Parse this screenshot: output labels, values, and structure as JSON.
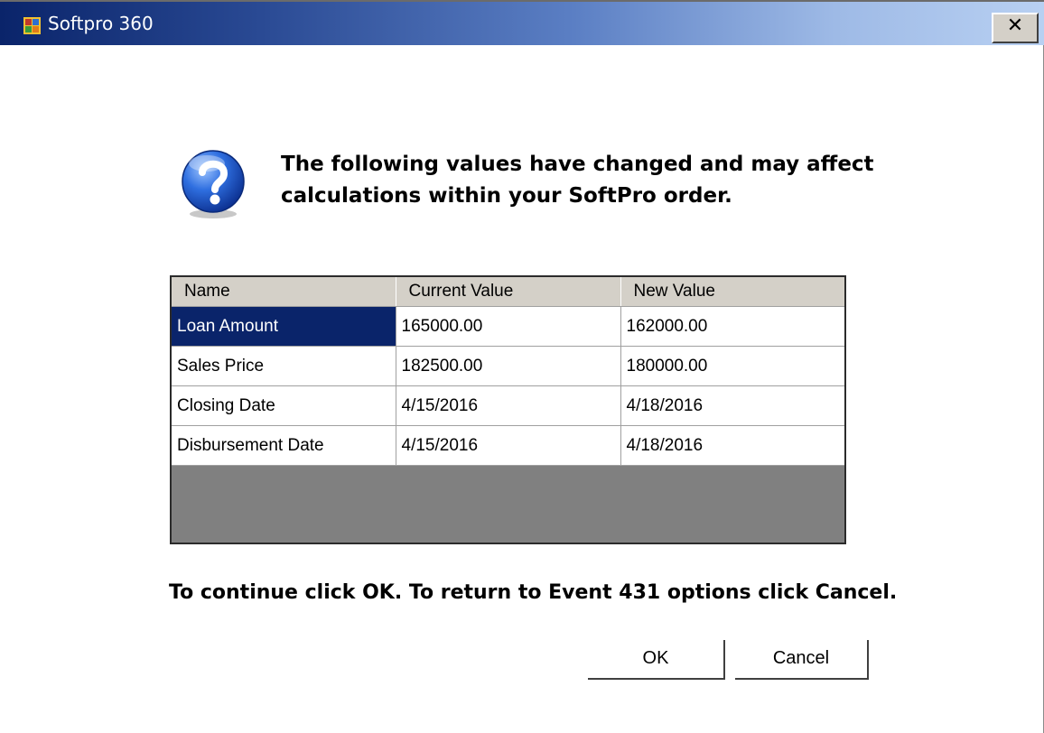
{
  "window": {
    "title": "Softpro 360",
    "app_icon": "softpro-app-icon",
    "close_label": "✕",
    "close_icon": "close-icon"
  },
  "dialog": {
    "icon": "question-icon",
    "message_line1": "The following values have changed and may affect",
    "message_line2": "calculations within your SoftPro order.",
    "table": {
      "columns": [
        "Name",
        "Current Value",
        "New Value"
      ],
      "rows": [
        {
          "name": "Loan Amount",
          "current": "165000.00",
          "new": "162000.00",
          "selected": true
        },
        {
          "name": "Sales Price",
          "current": "182500.00",
          "new": "180000.00",
          "selected": false
        },
        {
          "name": "Closing Date",
          "current": "4/15/2016",
          "new": "4/18/2016",
          "selected": false
        },
        {
          "name": "Disbursement Date",
          "current": "4/15/2016",
          "new": "4/18/2016",
          "selected": false
        }
      ]
    },
    "instruction": "To continue click OK. To return to Event 431 options click Cancel.",
    "ok_label": "OK",
    "cancel_label": "Cancel"
  },
  "colors": {
    "title_gradient_start": "#0a246a",
    "title_gradient_end": "#b8d0f2",
    "selected_row_bg": "#0a246a",
    "grid_empty_area": "#808080",
    "header_bg": "#d4d0c8"
  }
}
